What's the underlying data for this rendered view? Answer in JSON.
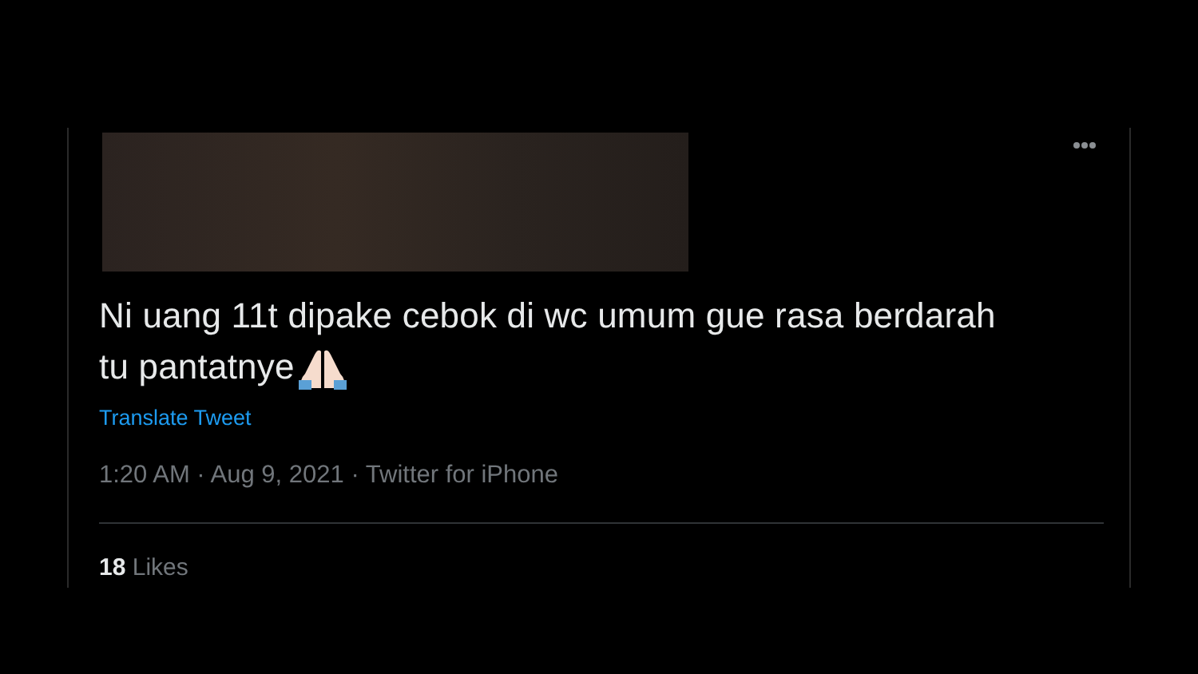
{
  "tweet": {
    "text_lines": [
      "Ni uang 11t dipake cebok di wc umum gue rasa berdarah",
      "tu pantatnye"
    ],
    "translate_link": "Translate Tweet",
    "meta": "1:20 AM · Aug 9, 2021 · Twitter for iPhone",
    "likes_count": "18",
    "likes_label": "Likes"
  }
}
